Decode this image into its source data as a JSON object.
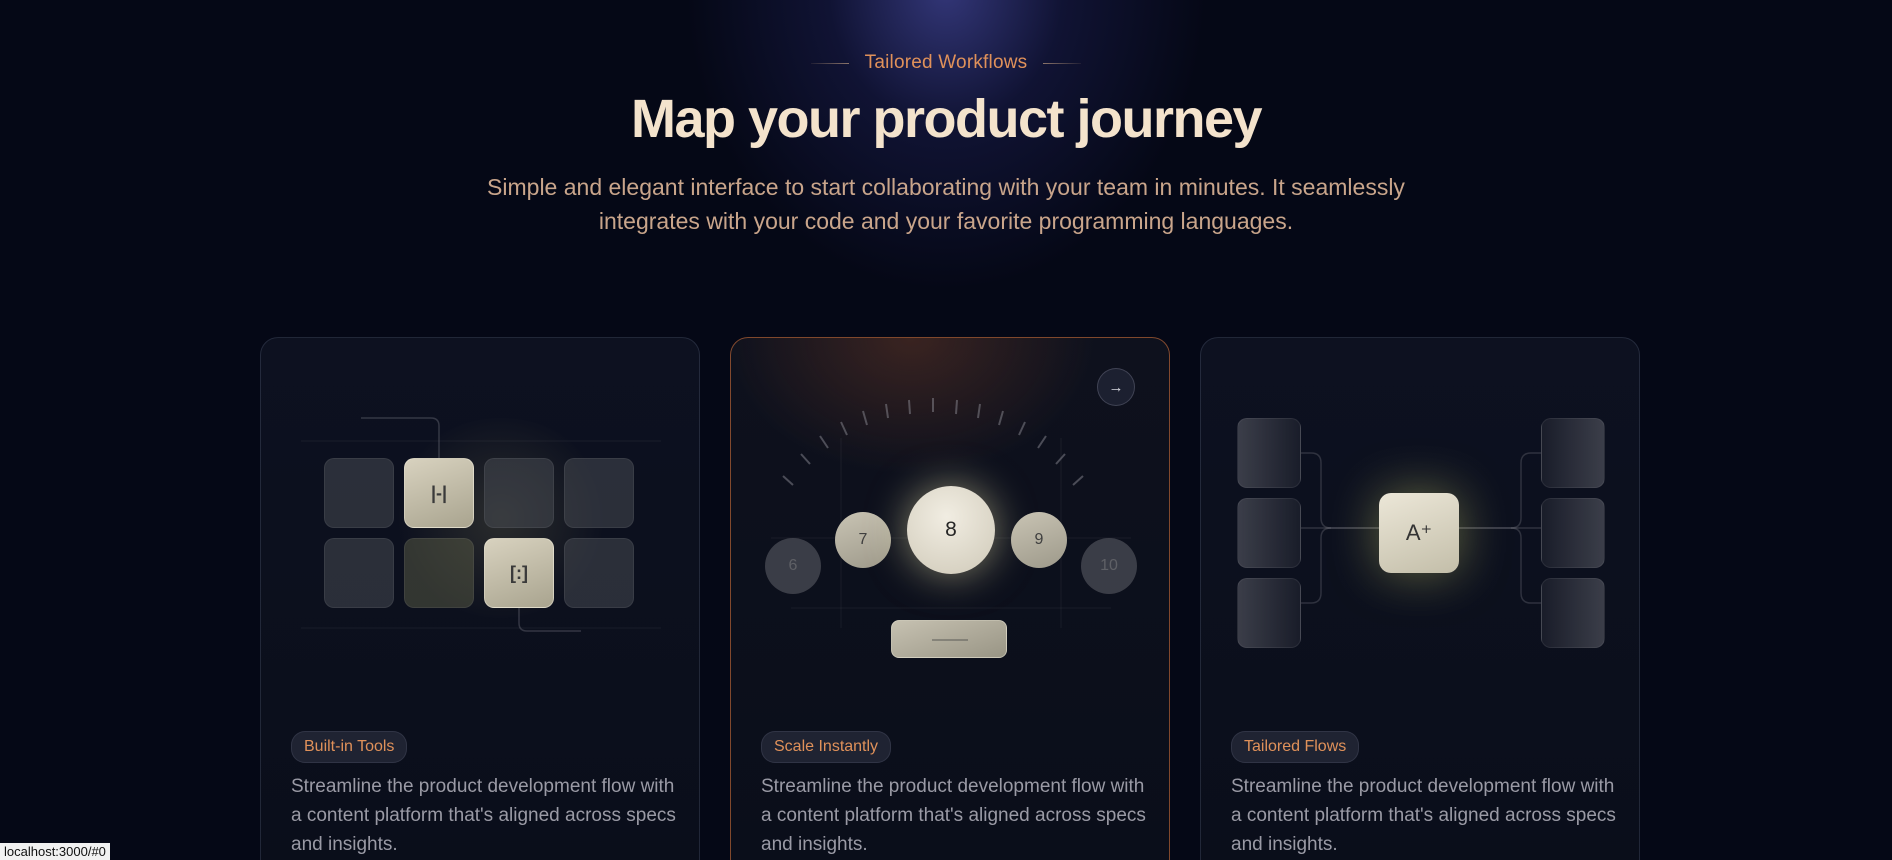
{
  "header": {
    "eyebrow": "Tailored Workflows",
    "title": "Map your product journey",
    "subtitle": "Simple and elegant interface to start collaborating with your team in minutes. It seamlessly integrates with your code and your favorite programming languages."
  },
  "cards": [
    {
      "tag": "Built-in Tools",
      "description": "Streamline the product development flow with a content platform that's aligned across specs and insights.",
      "icons": [
        "heading-icon",
        "frame-icon"
      ]
    },
    {
      "tag": "Scale Instantly",
      "description": "Streamline the product development flow with a content platform that's aligned across specs and insights.",
      "dial_values": [
        "6",
        "7",
        "8",
        "9",
        "10"
      ],
      "arrow": "→"
    },
    {
      "tag": "Tailored Flows",
      "description": "Streamline the product development flow with a content platform that's aligned across specs and insights.",
      "center_icon": "A⁺"
    }
  ],
  "status_bar": "localhost:3000/#0",
  "colors": {
    "accent": "#e0915a",
    "title": "#f4e3cc",
    "background": "#050816"
  }
}
